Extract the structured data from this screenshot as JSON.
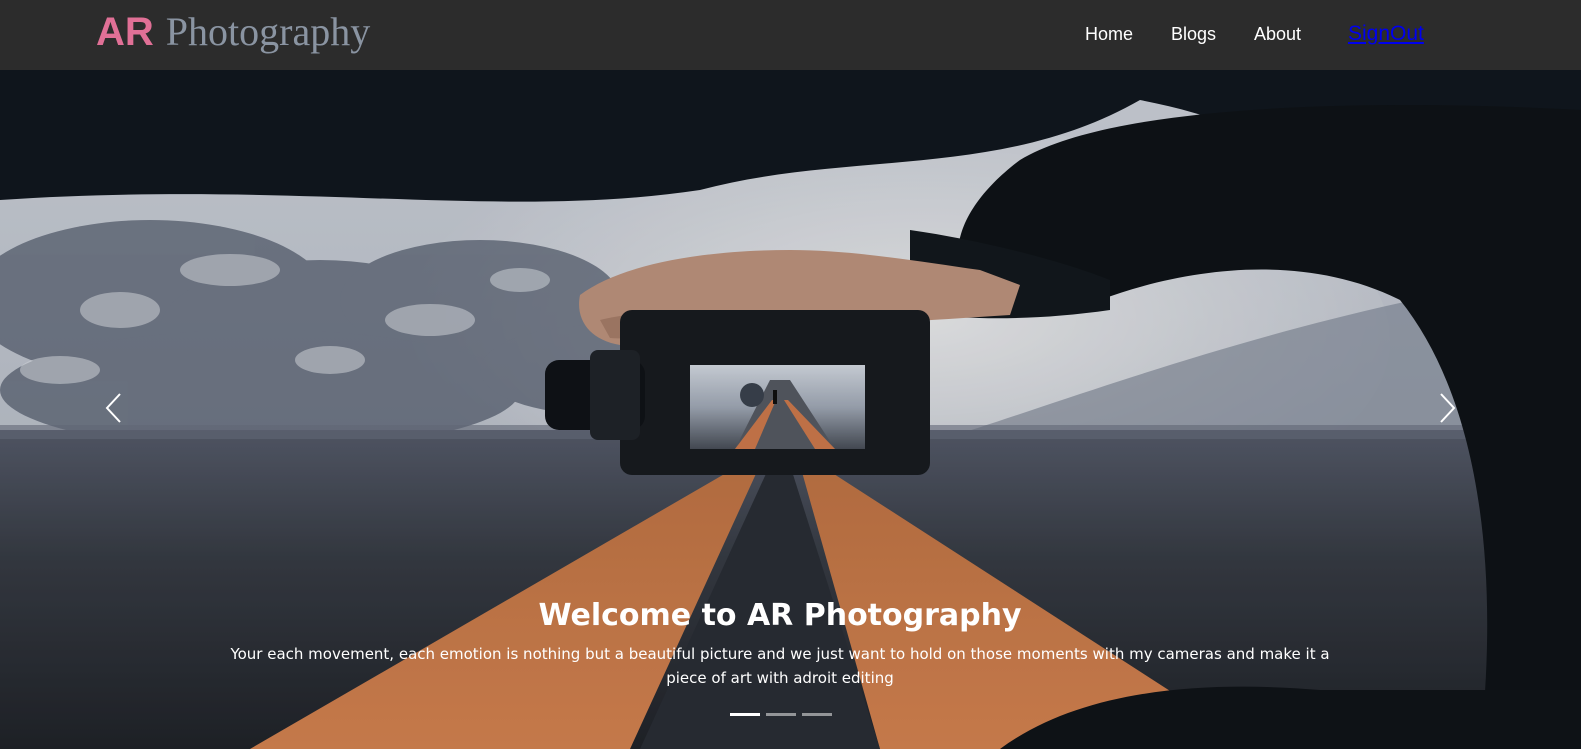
{
  "brand": {
    "ar": "AR",
    "photography": "Photography"
  },
  "nav": {
    "home": "Home",
    "blogs": "Blogs",
    "about": "About",
    "signout": "SignOut"
  },
  "carousel": {
    "title": "Welcome to AR Photography",
    "text": "Your each movement, each emotion is nothing but a beautiful picture and we just want to hold on those moments with my cameras and make it a piece of art with adroit editing",
    "prev_icon": "chevron-left-icon",
    "next_icon": "chevron-right-icon",
    "slide_count": 3,
    "active_slide": 1
  },
  "colors": {
    "navbar_bg": "#2c2c2c",
    "brand_ar": "#e07096",
    "brand_photography": "#8a94a2",
    "signout_link": "#0000ee"
  }
}
